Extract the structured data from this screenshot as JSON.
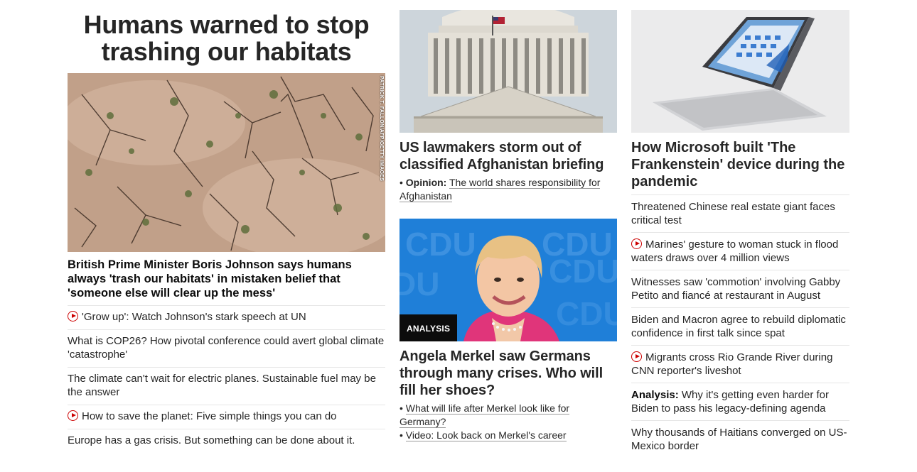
{
  "left": {
    "headline": "Humans warned to stop trashing our habitats",
    "image_credit": "PATRICK T. FALLON/AFP/GETTY IMAGES",
    "caption": "British Prime Minister Boris Johnson says humans always 'trash our habitats' in mistaken belief that 'someone else will clear up the mess'",
    "items": [
      {
        "text": "'Grow up': Watch Johnson's stark speech at UN",
        "video": true
      },
      {
        "text": "What is COP26? How pivotal conference could avert global climate 'catastrophe'",
        "video": false
      },
      {
        "text": "The climate can't wait for electric planes. Sustainable fuel may be the answer",
        "video": false
      },
      {
        "text": "How to save the planet: Five simple things you can do",
        "video": true
      },
      {
        "text": "Europe has a gas crisis. But something can be done about it.",
        "video": false
      }
    ]
  },
  "middle": {
    "story1": {
      "headline": "US lawmakers storm out of classified Afghanistan briefing",
      "sub_prefix": "Opinion:",
      "sub_text": "The world shares responsibility for Afghanistan"
    },
    "story2": {
      "badge": "ANALYSIS",
      "headline": "Angela Merkel saw Germans through many crises. Who will fill her shoes?",
      "links": [
        "What will life after Merkel look like for Germany?",
        "Video: Look back on Merkel's career"
      ]
    }
  },
  "right": {
    "headline": "How Microsoft built 'The Frankenstein' device during the pandemic",
    "items": [
      {
        "prefix": "",
        "text": "Threatened Chinese real estate giant faces critical test",
        "video": false
      },
      {
        "prefix": "",
        "text": "Marines' gesture to woman stuck in flood waters draws over 4 million views",
        "video": true
      },
      {
        "prefix": "",
        "text": "Witnesses saw 'commotion' involving Gabby Petito and fiancé at restaurant in August",
        "video": false
      },
      {
        "prefix": "",
        "text": "Biden and Macron agree to rebuild diplomatic confidence in first talk since spat",
        "video": false
      },
      {
        "prefix": "",
        "text": "Migrants cross Rio Grande River during CNN reporter's liveshot",
        "video": true
      },
      {
        "prefix": "Analysis:",
        "text": "Why it's getting even harder for Biden to pass his legacy-defining agenda",
        "video": false
      },
      {
        "prefix": "",
        "text": "Why thousands of Haitians converged on US-Mexico border",
        "video": false
      }
    ]
  },
  "colors": {
    "accent_red": "#cc0000",
    "text": "#262626",
    "divider": "#e6e6e6",
    "badge_bg": "#0c0c0c"
  }
}
